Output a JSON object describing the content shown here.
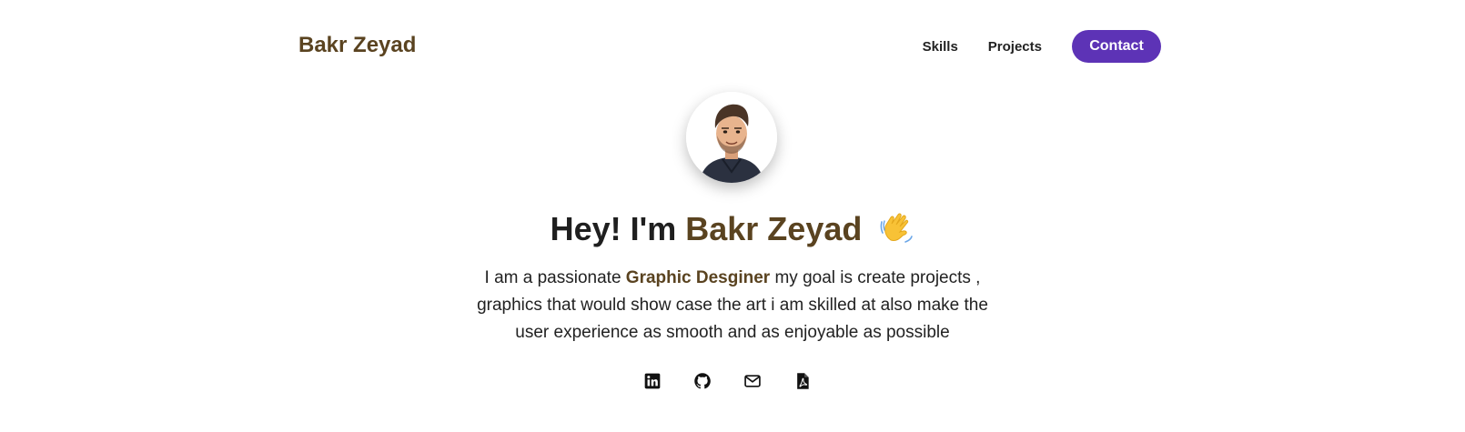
{
  "nav": {
    "brand": "Bakr Zeyad",
    "links": [
      "Skills",
      "Projects"
    ],
    "contact_label": "Contact"
  },
  "hero": {
    "avatar_icon": "avatar-illustration",
    "greeting": "Hey! I'm",
    "name": "Bakr Zeyad",
    "wave_icon": "waving-hand-emoji",
    "bio_before": "I am a passionate",
    "bio_role": "Graphic Desginer",
    "bio_after": "my goal is create projects , graphics that would show case the art i am skilled at also make the user experience as smooth and as enjoyable as possible"
  },
  "socials": [
    {
      "icon": "linkedin-icon"
    },
    {
      "icon": "github-icon"
    },
    {
      "icon": "email-icon"
    },
    {
      "icon": "pdf-resume-icon"
    }
  ],
  "colors": {
    "accent": "#5d33b6",
    "brand_text": "#5a4320",
    "text": "#1f1f1f"
  }
}
